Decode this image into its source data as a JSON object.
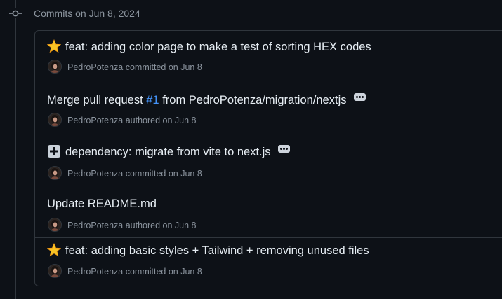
{
  "group": {
    "header": "Commits on Jun 8, 2024"
  },
  "commits": [
    {
      "emoji": "glowing-star-icon",
      "title": "feat: adding color page to make a test of sorting HEX codes",
      "author": "PedroPotenza",
      "action": "committed on Jun 8"
    },
    {
      "title_prefix": "Merge pull request ",
      "pr_link": "#1",
      "title_suffix": " from PedroPotenza/migration/nextjs",
      "has_ellipsis": true,
      "author": "PedroPotenza",
      "action": "authored on Jun 8"
    },
    {
      "emoji": "heavy-plus-icon",
      "title": "dependency: migrate from vite to next.js",
      "has_ellipsis": true,
      "author": "PedroPotenza",
      "action": "committed on Jun 8"
    },
    {
      "title": "Update README.md",
      "author": "PedroPotenza",
      "action": "authored on Jun 8"
    },
    {
      "emoji": "glowing-star-icon",
      "title": "feat: adding basic styles + Tailwind + removing unused files",
      "author": "PedroPotenza",
      "action": "committed on Jun 8"
    }
  ],
  "colors": {
    "background": "#0d1117",
    "border": "#30363d",
    "text_primary": "#e6edf3",
    "text_muted": "#8b949e",
    "link": "#4493f8"
  }
}
